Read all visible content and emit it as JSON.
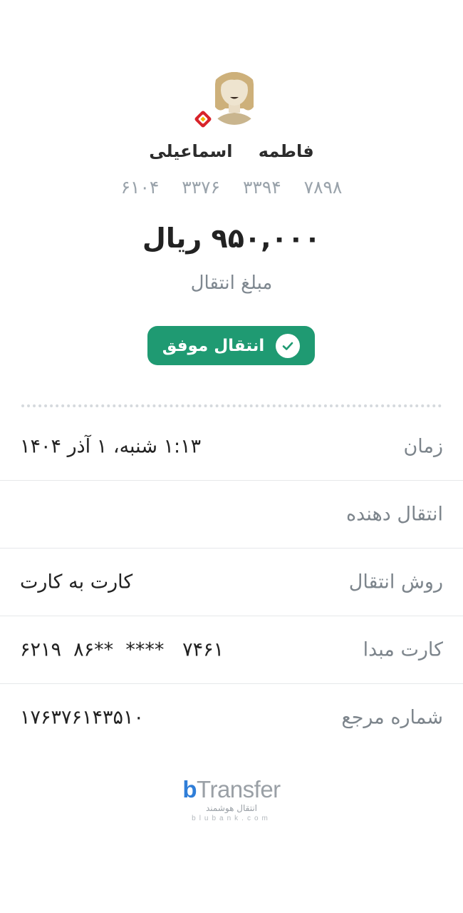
{
  "recipient": {
    "first_name": "فاطمه",
    "last_name": "اسماعیلی",
    "card_groups": [
      "۶۱۰۴",
      "۳۳۷۶",
      "۳۳۹۴",
      "۷۸۹۸"
    ]
  },
  "amount": {
    "value": "۹۵۰,۰۰۰ ریال",
    "caption": "مبلغ انتقال"
  },
  "status": {
    "label": "انتقال موفق",
    "color": "#1f9a72"
  },
  "details": [
    {
      "key": "زمان",
      "value": "۱:۱۳ شنبه، ۱ آذر ۱۴۰۴"
    },
    {
      "key": "انتقال دهنده",
      "value": ""
    },
    {
      "key": "روش انتقال",
      "value": "کارت به کارت"
    },
    {
      "key": "کارت مبدا",
      "value": "۶۲۱۹  ۸۶**  ****   ۷۴۶۱"
    },
    {
      "key": "شماره مرجع",
      "value": "۱۷۶۳۷۶۱۴۳۵۱۰"
    }
  ],
  "brand": {
    "logo_b": "b",
    "logo_text": "Transfer",
    "subtitle": "انتقال هوشمند",
    "site": "blubank.com"
  },
  "icons": {
    "avatar": "person-avatar-icon",
    "bank": "bank-logo-icon",
    "check": "check-circle-icon"
  }
}
